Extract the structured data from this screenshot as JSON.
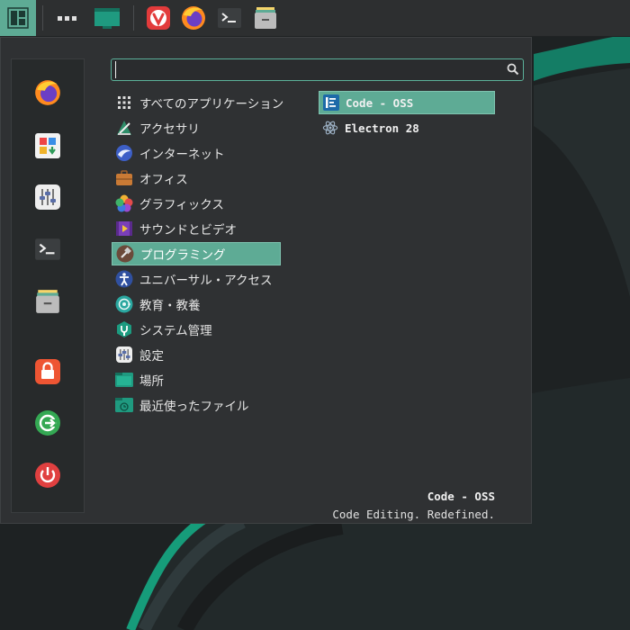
{
  "panel": {
    "icons": [
      "manjaro-logo-icon",
      "window-list-icon",
      "show-desktop-icon",
      "vivaldi-icon",
      "firefox-icon",
      "terminal-icon",
      "file-manager-icon"
    ]
  },
  "favorites": [
    "firefox-icon",
    "software-store-icon",
    "settings-icon",
    "terminal-icon",
    "file-manager-icon",
    "lock-screen-icon",
    "logout-icon",
    "power-icon"
  ],
  "search": {
    "value": "",
    "placeholder": ""
  },
  "categories": [
    {
      "label": "すべてのアプリケーション",
      "icon": "grid-icon"
    },
    {
      "label": "アクセサリ",
      "icon": "accessories-icon"
    },
    {
      "label": "インターネット",
      "icon": "internet-icon"
    },
    {
      "label": "オフィス",
      "icon": "office-icon"
    },
    {
      "label": "グラフィックス",
      "icon": "graphics-icon"
    },
    {
      "label": "サウンドとビデオ",
      "icon": "multimedia-icon"
    },
    {
      "label": "プログラミング",
      "icon": "development-icon",
      "selected": true
    },
    {
      "label": "ユニバーサル・アクセス",
      "icon": "accessibility-icon"
    },
    {
      "label": "教育・教養",
      "icon": "education-icon"
    },
    {
      "label": "システム管理",
      "icon": "system-icon"
    },
    {
      "label": "設定",
      "icon": "settings-icon"
    },
    {
      "label": "場所",
      "icon": "places-folder-icon"
    },
    {
      "label": "最近使ったファイル",
      "icon": "recent-files-icon"
    }
  ],
  "apps": [
    {
      "label": "Code - OSS",
      "icon": "code-oss-icon",
      "selected": true
    },
    {
      "label": "Electron 28",
      "icon": "electron-icon"
    }
  ],
  "description": {
    "title": "Code - OSS",
    "text": "Code Editing. Redefined."
  },
  "colors": {
    "accent": "#5eab95",
    "panel": "#2d2f30",
    "menu_bg": "#2f3133"
  }
}
